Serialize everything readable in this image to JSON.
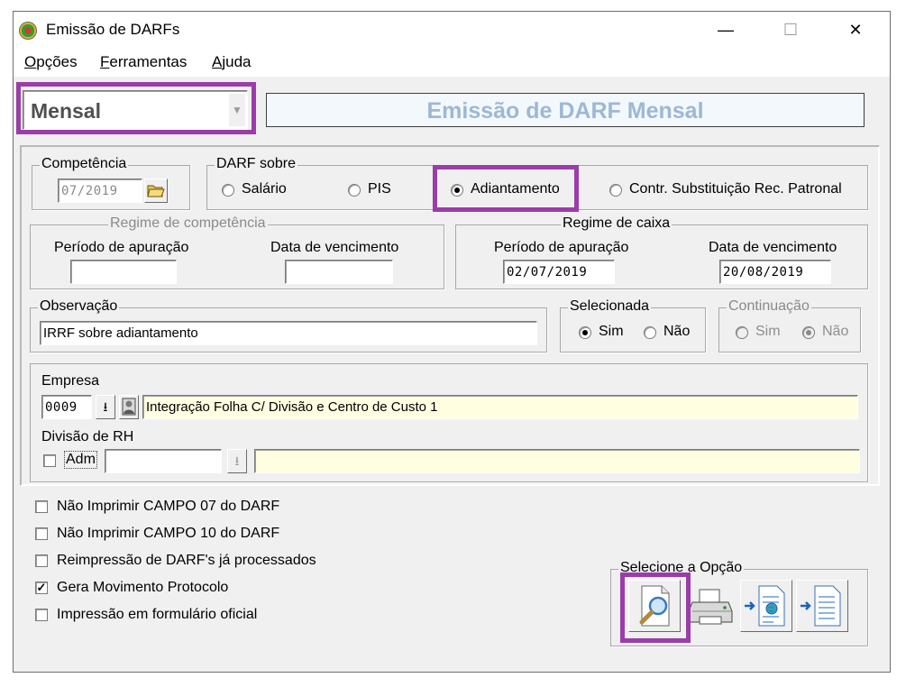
{
  "window": {
    "title": "Emissão de DARFs",
    "minimize": "—",
    "maximize": "☐",
    "close": "✕"
  },
  "menu": [
    "Opções",
    "Ferramentas",
    "Ajuda"
  ],
  "header": {
    "period_type": "Mensal",
    "banner": "Emissão de DARF Mensal"
  },
  "competencia": {
    "label": "Competência",
    "value": "07/2019"
  },
  "darf_sobre": {
    "label": "DARF sobre",
    "options": [
      "Salário",
      "PIS",
      "Adiantamento",
      "Contr. Substituição Rec. Patronal"
    ],
    "selected": "Adiantamento"
  },
  "regime_competencia": {
    "label": "Regime de competência",
    "periodo_label": "Período de apuração",
    "periodo_value": "",
    "vencimento_label": "Data de vencimento",
    "vencimento_value": ""
  },
  "regime_caixa": {
    "label": "Regime de caixa",
    "periodo_label": "Período de apuração",
    "periodo_value": "02/07/2019",
    "vencimento_label": "Data de vencimento",
    "vencimento_value": "20/08/2019"
  },
  "observacao": {
    "label": "Observação",
    "value": "IRRF sobre adiantamento"
  },
  "selecionada": {
    "label": "Selecionada",
    "options": [
      "Sim",
      "Não"
    ],
    "selected": "Sim"
  },
  "continuacao": {
    "label": "Continuação",
    "options": [
      "Sim",
      "Não"
    ],
    "selected": "Não"
  },
  "empresa": {
    "label": "Empresa",
    "code": "0009",
    "name": "Integração Folha C/ Divisão e Centro de Custo 1"
  },
  "divisao": {
    "label": "Divisão de RH",
    "adm_label": "Adm",
    "adm_checked": false,
    "code": "",
    "name": ""
  },
  "options": [
    {
      "label": "Não Imprimir CAMPO 07 do DARF",
      "checked": false
    },
    {
      "label": "Não Imprimir CAMPO 10 do DARF",
      "checked": false
    },
    {
      "label": "Reimpressão de DARF's já processados",
      "checked": false
    },
    {
      "label": "Gera Movimento Protocolo",
      "checked": true
    },
    {
      "label": "Impressão em formulário oficial",
      "checked": false
    }
  ],
  "actions": {
    "label": "Selecione a Opção",
    "buttons": [
      "preview-icon",
      "printer-icon",
      "export-web-icon",
      "export-file-icon"
    ]
  },
  "colors": {
    "highlight": "#9b3da8",
    "banner_text": "#9db8d4",
    "field_yellow": "#fffee0"
  }
}
